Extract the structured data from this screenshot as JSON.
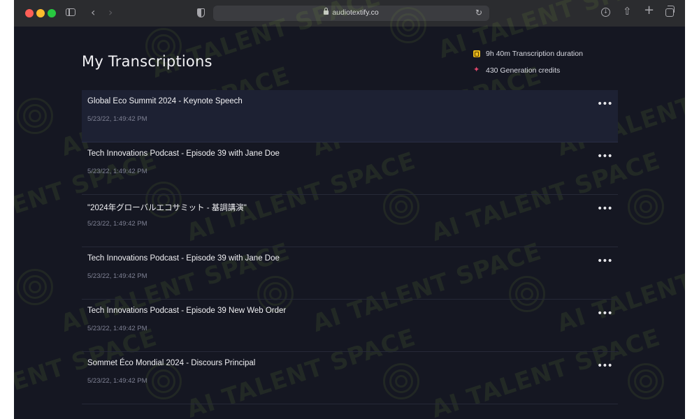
{
  "browser": {
    "url": "audiotextify.co"
  },
  "page": {
    "title": "My Transcriptions"
  },
  "stats": {
    "duration_text": "9h 40m Transcription duration",
    "credits_text": "430 Generation credits"
  },
  "watermark": {
    "text": "AI TALENT SPACE"
  },
  "transcriptions": [
    {
      "title": "Global Eco Summit 2024 - Keynote Speech",
      "date": "5/23/22, 1:49:42 PM"
    },
    {
      "title": "Tech Innovations Podcast - Episode 39 with Jane Doe",
      "date": "5/23/22, 1:49:42 PM"
    },
    {
      "title": "\"2024年グローバルエコサミット - 基調講演\"",
      "date": "5/23/22, 1:49:42 PM"
    },
    {
      "title": "Tech Innovations Podcast - Episode 39 with Jane Doe",
      "date": "5/23/22, 1:49:42 PM"
    },
    {
      "title": "Tech Innovations Podcast - Episode 39 New Web Order",
      "date": "5/23/22, 1:49:42 PM"
    },
    {
      "title": "Sommet Éco Mondial 2024 - Discours Principal",
      "date": "5/23/22, 1:49:42 PM"
    }
  ],
  "colors": {
    "background": "#151722",
    "row_highlight": "#1d2133",
    "duration_icon": "#e8b91a",
    "credits_icon": "#e0466b"
  }
}
